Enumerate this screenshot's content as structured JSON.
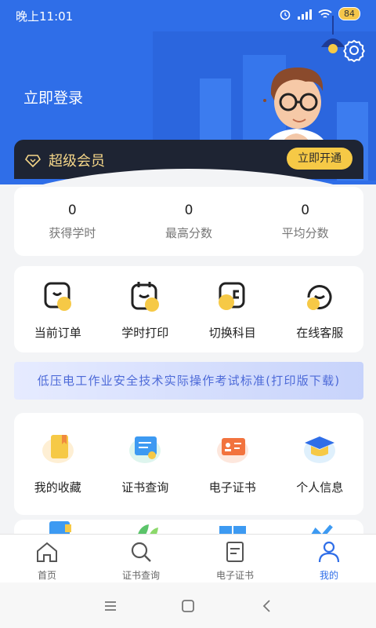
{
  "status_bar": {
    "time": "晚上11:01",
    "battery": "84"
  },
  "header": {
    "login_text": "立即登录"
  },
  "vip": {
    "label": "超级会员",
    "button": "立即开通"
  },
  "stats": [
    {
      "value": "0",
      "label": "获得学时"
    },
    {
      "value": "0",
      "label": "最高分数"
    },
    {
      "value": "0",
      "label": "平均分数"
    }
  ],
  "quick_actions": [
    {
      "label": "当前订单",
      "icon": "order-icon"
    },
    {
      "label": "学时打印",
      "icon": "calendar-print-icon"
    },
    {
      "label": "切换科目",
      "icon": "switch-subject-icon"
    },
    {
      "label": "在线客服",
      "icon": "customer-service-icon"
    }
  ],
  "banner": {
    "text": "低压电工作业安全技术实际操作考试标准(打印版下载)"
  },
  "features": [
    {
      "label": "我的收藏",
      "icon": "bookmark-icon"
    },
    {
      "label": "证书查询",
      "icon": "certificate-query-icon"
    },
    {
      "label": "电子证书",
      "icon": "id-card-icon"
    },
    {
      "label": "个人信息",
      "icon": "graduation-cap-icon"
    }
  ],
  "tabs": [
    {
      "label": "首页",
      "icon": "home-icon",
      "active": false
    },
    {
      "label": "证书查询",
      "icon": "search-icon",
      "active": false
    },
    {
      "label": "电子证书",
      "icon": "certificate-icon",
      "active": false
    },
    {
      "label": "我的",
      "icon": "user-icon",
      "active": true
    }
  ],
  "colors": {
    "primary": "#2f6ee8",
    "accent": "#f6c946",
    "vip_bg": "#1e2433"
  }
}
